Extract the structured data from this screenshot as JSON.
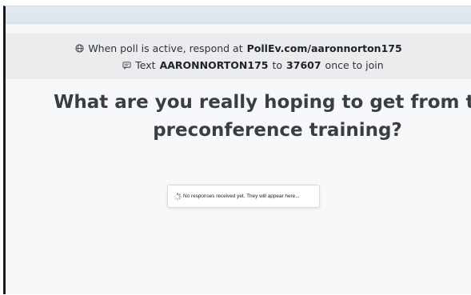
{
  "banner": {
    "respond_prefix": "When poll is active, respond at",
    "respond_url": "PollEv.com/aaronnorton175",
    "text_prefix": "Text",
    "text_code": "AARONNORTON175",
    "text_to": "to",
    "text_number": "37607",
    "text_suffix": "once to join"
  },
  "question": {
    "line1": "What are you really hoping to get from today's",
    "line2": "preconference training?"
  },
  "responses": {
    "empty_message": "No responses received yet. They will appear here..."
  },
  "icons": {
    "respond": "globe-icon",
    "text": "sms-icon",
    "loading": "spinner-icon"
  }
}
